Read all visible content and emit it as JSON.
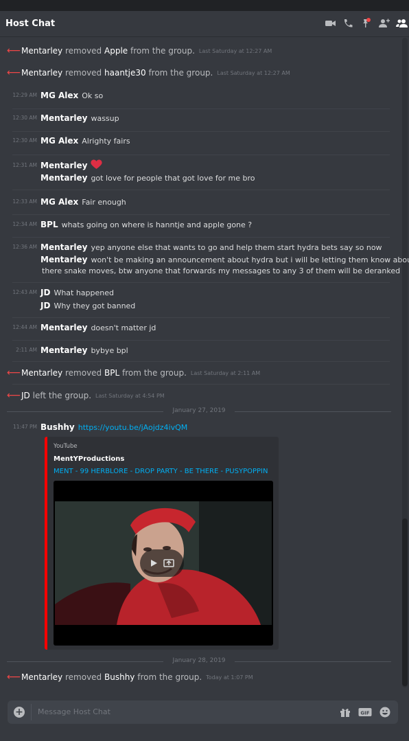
{
  "header": {
    "title": "Host Chat",
    "icons": [
      "video-call-icon",
      "phone-icon",
      "pin-icon",
      "add-member-icon",
      "member-list-icon"
    ]
  },
  "system_events": [
    {
      "actor": "Mentarley",
      "action": "removed",
      "target": "Apple",
      "suffix": "from the group.",
      "time": "Last Saturday at 12:27 AM"
    },
    {
      "actor": "Mentarley",
      "action": "removed",
      "target": "haantje30",
      "suffix": "from the group.",
      "time": "Last Saturday at 12:27 AM"
    },
    {
      "actor": "Mentarley",
      "action": "removed",
      "target": "BPL",
      "suffix": "from the group.",
      "time": "Last Saturday at 2:11 AM"
    },
    {
      "actor": "JD",
      "action": "left the group.",
      "target": "",
      "suffix": "",
      "time": "Last Saturday at 4:54 PM"
    },
    {
      "actor": "Mentarley",
      "action": "removed",
      "target": "Bushhy",
      "suffix": "from the group.",
      "time": "Today at 1:07 PM"
    }
  ],
  "messages": [
    {
      "time": "12:29 AM",
      "lines": [
        {
          "author": "MG Alex",
          "text": "Ok so"
        }
      ]
    },
    {
      "time": "12:30 AM",
      "lines": [
        {
          "author": "Mentarley",
          "text": "wassup"
        }
      ]
    },
    {
      "time": "12:30 AM",
      "lines": [
        {
          "author": "MG Alex",
          "text": "Alrighty fairs"
        }
      ]
    },
    {
      "time": "12:31 AM",
      "lines": [
        {
          "author": "Mentarley",
          "text": ""
        },
        {
          "author": "Mentarley",
          "text": "got love for people that got love for me bro"
        }
      ]
    },
    {
      "time": "12:33 AM",
      "lines": [
        {
          "author": "MG Alex",
          "text": "Fair enough"
        }
      ]
    },
    {
      "time": "12:34 AM",
      "lines": [
        {
          "author": "BPL",
          "text": "whats going on where is hanntje and apple gone ?"
        }
      ]
    },
    {
      "time": "12:36 AM",
      "lines": [
        {
          "author": "Mentarley",
          "text": "yep anyone else that wants to go and help them start hydra bets say so now"
        },
        {
          "author": "Mentarley",
          "text": "won't be making an announcement about hydra but i will be letting them know about"
        },
        {
          "author": "",
          "text": "there snake moves, btw anyone that forwards my messages to any 3 of them will be deranked"
        }
      ]
    },
    {
      "time": "12:43 AM",
      "lines": [
        {
          "author": "JD",
          "text": "What happened"
        },
        {
          "author": "JD",
          "text": "Why they got banned"
        }
      ]
    },
    {
      "time": "12:44 AM",
      "lines": [
        {
          "author": "Mentarley",
          "text": "doesn't matter jd"
        }
      ]
    },
    {
      "time": "2:11 AM",
      "lines": [
        {
          "author": "Mentarley",
          "text": "bybye bpl"
        }
      ]
    },
    {
      "time": "11:47 PM",
      "lines": [
        {
          "author": "Bushhy",
          "text": "https://youtu.be/jAojdz4ivQM"
        }
      ]
    }
  ],
  "date_separators": [
    "January 27, 2019",
    "January 28, 2019"
  ],
  "embed": {
    "provider": "YouTube",
    "author": "MentYProductions",
    "title": "MENT - 99 HERBLORE - DROP PARTY - BE THERE - PUSYPOPPIN",
    "accent_color": "#ff0000"
  },
  "composer": {
    "placeholder": "Message Host Chat",
    "icons": [
      "upload-plus-icon",
      "gift-icon",
      "gif-icon",
      "emoji-icon"
    ]
  },
  "colors": {
    "background": "#36393f",
    "link": "#00b0f4",
    "system_arrow": "#f04747",
    "heart": "#dd2e44"
  }
}
